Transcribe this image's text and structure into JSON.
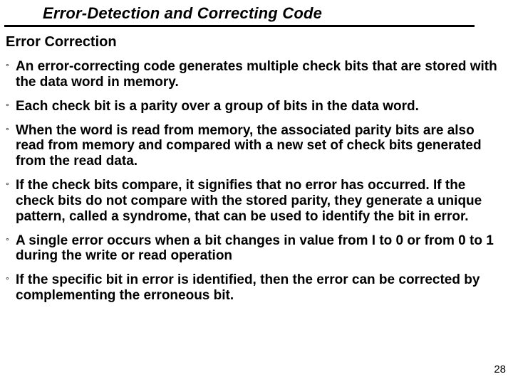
{
  "title": "Error-Detection and Correcting Code",
  "subheading": "Error Correction",
  "bullets": [
    "An error-correcting code generates multiple check bits that are stored with the data word in memory.",
    "Each check bit is a parity over a group of bits in the data word.",
    "When the word is read from memory, the associated parity bits are also read from memory and compared with a new set of check bits generated from the read data.",
    " If the check bits compare, it signifies that no error has occurred.  If the check bits do not compare with the stored parity, they generate a unique pattern, called a syndrome, that can be used to identify the bit in error.",
    "A single error occurs when a bit changes in value from I to 0 or from 0 to 1 during the write or read operation",
    " If the specific bit in error is identified, then the error can be corrected by complementing the erroneous bit."
  ],
  "bullet_mark": "°",
  "page_number": "28"
}
